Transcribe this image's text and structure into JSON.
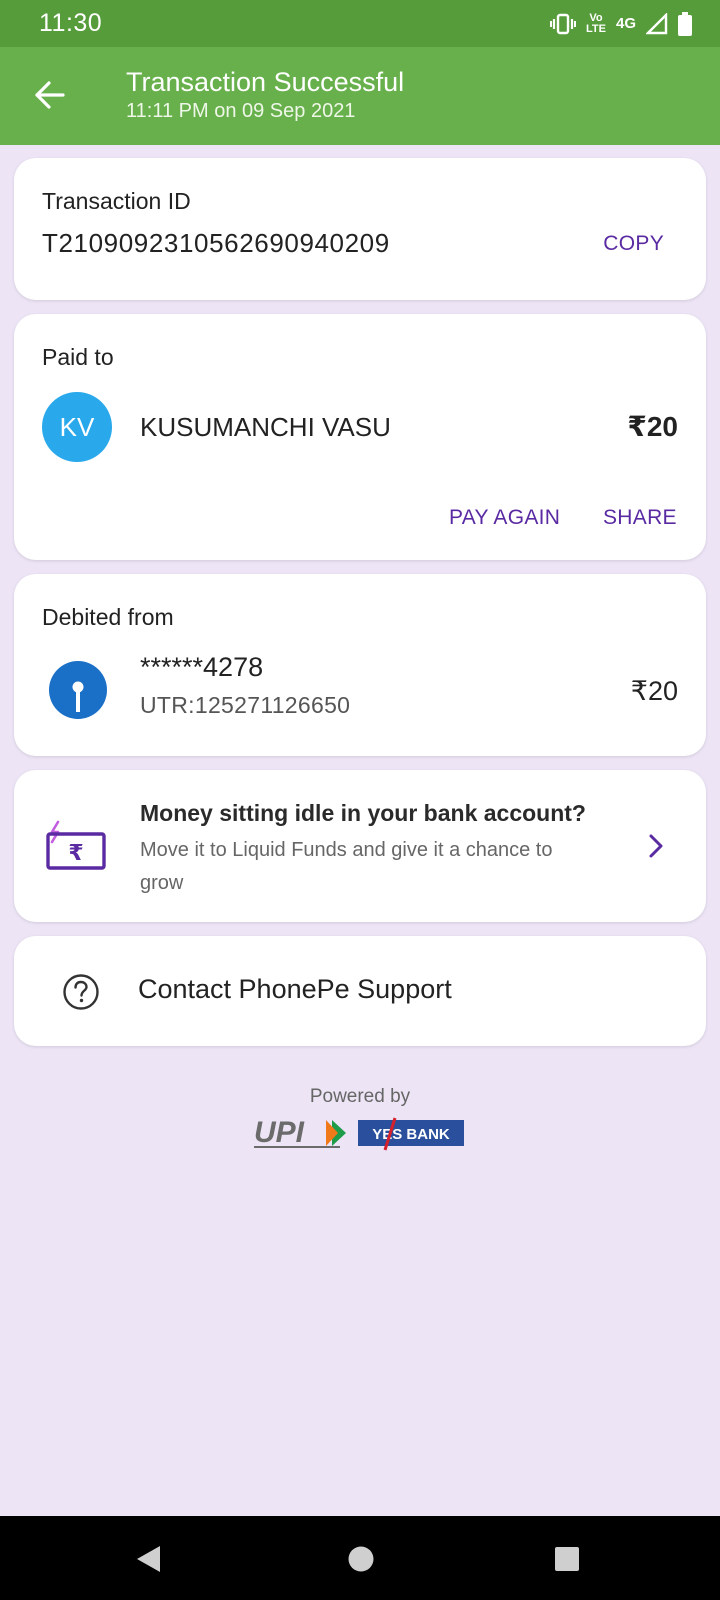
{
  "status_bar": {
    "time": "11:30",
    "lte_label_top": "Vo",
    "lte_label_bottom": "LTE",
    "network": "4G"
  },
  "app_bar": {
    "title": "Transaction Successful",
    "subtitle": "11:11 PM on 09 Sep 2021"
  },
  "transaction": {
    "label": "Transaction ID",
    "id": "T2109092310562690940209",
    "copy_label": "COPY"
  },
  "paid_to": {
    "label": "Paid to",
    "initials": "KV",
    "name": "KUSUMANCHI VASU",
    "amount": "₹20",
    "pay_again_label": "PAY AGAIN",
    "share_label": "SHARE",
    "avatar_color": "#29a9ec"
  },
  "debited_from": {
    "label": "Debited from",
    "account": "******4278",
    "utr": "UTR:125271126650",
    "amount": "₹20"
  },
  "promo": {
    "title": "Money sitting idle in your bank account?",
    "description": "Move it to Liquid Funds and give it a chance to grow",
    "icon": "liquid-funds-icon"
  },
  "support": {
    "label": "Contact PhonePe Support",
    "icon": "help-icon"
  },
  "footer": {
    "powered_by": "Powered by",
    "upi_logo_text": "UPI",
    "bank_logo_text": "YES BANK"
  },
  "colors": {
    "status_bar": "#569c3a",
    "app_bar": "#67b04b",
    "accent": "#5a2aa2",
    "background": "#ede5f6"
  }
}
